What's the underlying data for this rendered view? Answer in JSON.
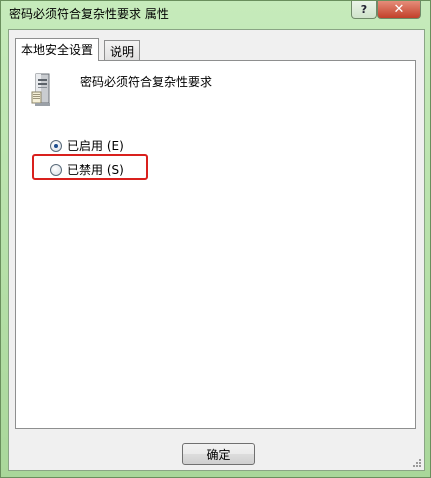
{
  "window": {
    "title": "密码必须符合复杂性要求 属性",
    "help_label": "?",
    "close_label": "✕"
  },
  "tabs": [
    {
      "label": "本地安全设置",
      "active": true
    },
    {
      "label": "说明",
      "active": false
    }
  ],
  "policy": {
    "icon": "server-icon",
    "name": "密码必须符合复杂性要求"
  },
  "options": [
    {
      "label": "已启用 (E)",
      "checked": true
    },
    {
      "label": "已禁用 (S)",
      "checked": false
    }
  ],
  "buttons": {
    "ok_label": "确定"
  },
  "colors": {
    "window_frame": "#b7e0a9",
    "highlight": "#d9201d",
    "radio_dot": "#1d4e8f"
  }
}
